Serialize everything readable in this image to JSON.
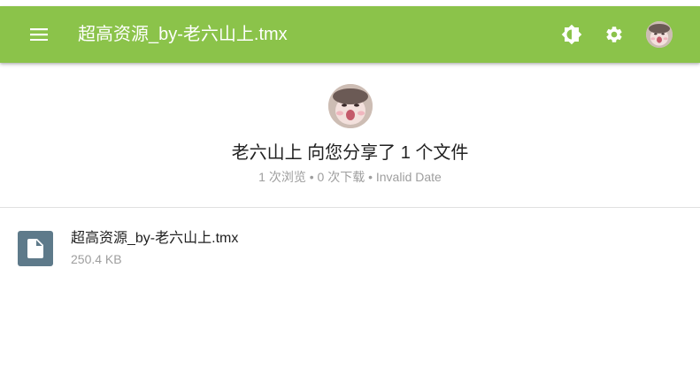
{
  "appbar": {
    "title": "超高资源_by-老六山上.tmx",
    "menu_icon": "menu-icon",
    "theme_icon": "brightness-icon",
    "settings_icon": "gear-icon",
    "background": "#8bc34a"
  },
  "share": {
    "title": "老六山上 向您分享了 1 个文件",
    "meta": "1 次浏览 • 0 次下载 • Invalid Date"
  },
  "file": {
    "name": "超高资源_by-老六山上.tmx",
    "size": "250.4 KB",
    "icon": "file-icon",
    "icon_background": "#5e7a8a"
  }
}
